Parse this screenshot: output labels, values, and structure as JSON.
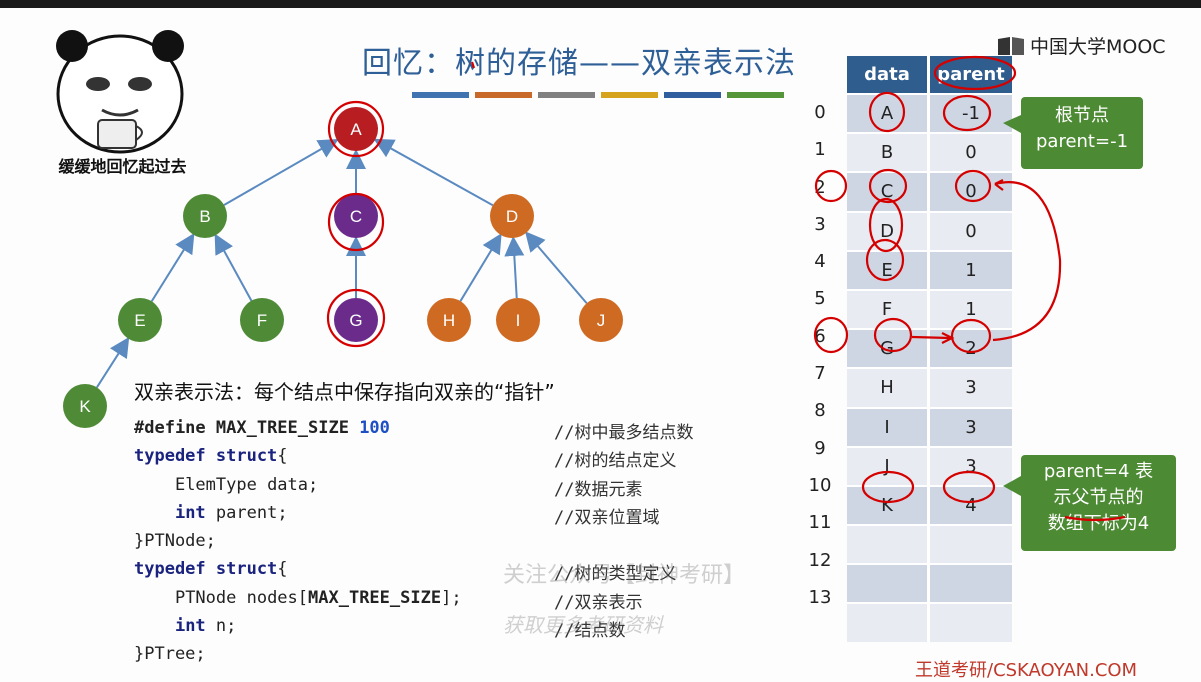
{
  "title": "回忆：树的存储——双亲表示法",
  "logo": "中国大学MOOC",
  "meme_caption": "缓缓地回忆起过去",
  "title_bar_colors": [
    "#3f74b0",
    "#c8692a",
    "#808080",
    "#d6a31c",
    "#2f5d9e",
    "#56963a"
  ],
  "tree": {
    "nodes": [
      {
        "id": "A",
        "color": "#b81d22"
      },
      {
        "id": "B",
        "color": "#4f8b37"
      },
      {
        "id": "C",
        "color": "#6a2b8a"
      },
      {
        "id": "D",
        "color": "#cf6a22"
      },
      {
        "id": "E",
        "color": "#4f8b37"
      },
      {
        "id": "F",
        "color": "#4f8b37"
      },
      {
        "id": "G",
        "color": "#6a2b8a"
      },
      {
        "id": "H",
        "color": "#cf6a22"
      },
      {
        "id": "I",
        "color": "#cf6a22"
      },
      {
        "id": "J",
        "color": "#cf6a22"
      },
      {
        "id": "K",
        "color": "#4f8b37"
      }
    ],
    "edge_color": "#5a8ac0"
  },
  "description": "双亲表示法：每个结点中保存指向双亲的“指针”",
  "code": {
    "l1": {
      "kw": "#define ",
      "name": "MAX_TREE_SIZE ",
      "num": "100",
      "comment": "//树中最多结点数"
    },
    "l2": {
      "kw": "typedef struct",
      "rest": "{",
      "comment": "//树的结点定义"
    },
    "l3": {
      "indent": "    ",
      "rest": "ElemType data;",
      "comment": "//数据元素"
    },
    "l4": {
      "indent": "    ",
      "kw": "int ",
      "rest": "parent;",
      "comment": "//双亲位置域"
    },
    "l5": {
      "rest": "}PTNode;"
    },
    "l6": {
      "kw": "typedef struct",
      "rest": "{",
      "comment": "//树的类型定义"
    },
    "l7": {
      "indent": "    ",
      "rest": "PTNode nodes[",
      "name": "MAX_TREE_SIZE",
      "rest2": "];",
      "comment": "//双亲表示"
    },
    "l8": {
      "indent": "    ",
      "kw": "int ",
      "rest": "n;",
      "comment": "//结点数"
    },
    "l9": {
      "rest": "}PTree;"
    }
  },
  "table": {
    "headers": {
      "data": "data",
      "parent": "parent"
    },
    "indices": [
      "0",
      "1",
      "2",
      "3",
      "4",
      "5",
      "6",
      "7",
      "8",
      "9",
      "10",
      "11",
      "12",
      "13"
    ],
    "rows": [
      {
        "data": "A",
        "parent": "-1"
      },
      {
        "data": "B",
        "parent": "0"
      },
      {
        "data": "C",
        "parent": "0"
      },
      {
        "data": "D",
        "parent": "0"
      },
      {
        "data": "E",
        "parent": "1"
      },
      {
        "data": "F",
        "parent": "1"
      },
      {
        "data": "G",
        "parent": "2"
      },
      {
        "data": "H",
        "parent": "3"
      },
      {
        "data": "I",
        "parent": "3"
      },
      {
        "data": "J",
        "parent": "3"
      },
      {
        "data": "K",
        "parent": "4"
      },
      {
        "data": "",
        "parent": ""
      },
      {
        "data": "",
        "parent": ""
      },
      {
        "data": "",
        "parent": ""
      }
    ]
  },
  "callouts": {
    "root": {
      "line1": "根节点",
      "line2": "parent=-1"
    },
    "k": {
      "line1": "parent=4 表",
      "line2": "示父节点的",
      "line3": "数组下标为4"
    }
  },
  "watermark": {
    "line1": "关注公众号【封神考研】",
    "line2": "获取更多考研资料"
  },
  "footer": "王道考研/CSKAOYAN.COM"
}
